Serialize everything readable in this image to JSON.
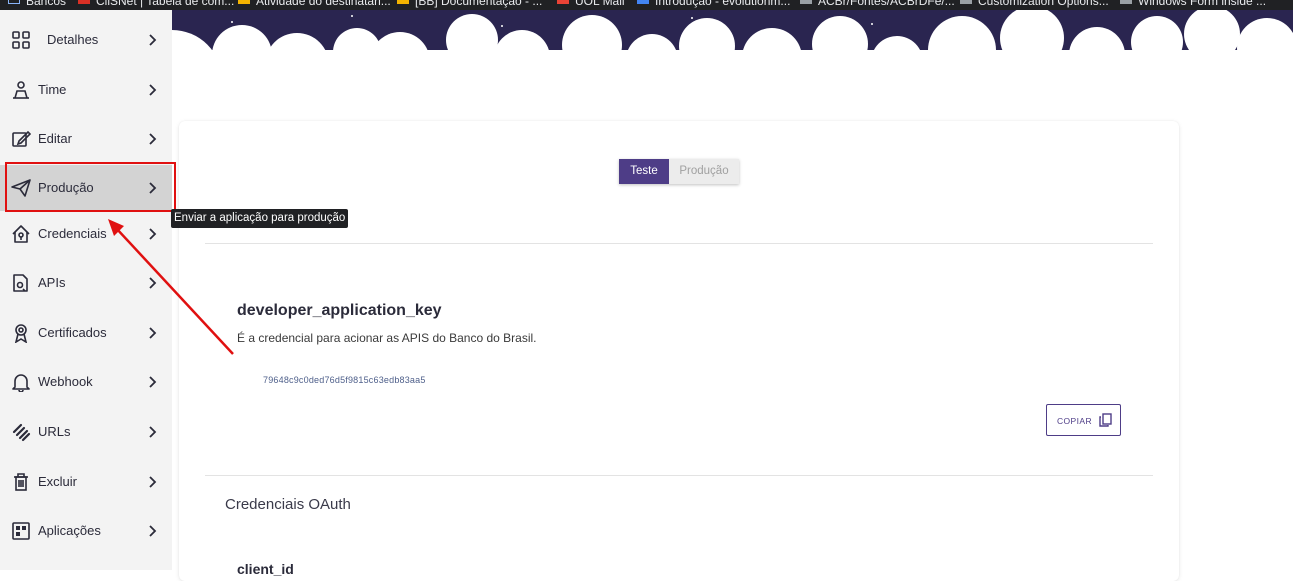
{
  "bookmarks": [
    {
      "label": "Bancos",
      "color": "#8ab4f8"
    },
    {
      "label": "CliSNet | Tabela de com...",
      "color": "#d93025"
    },
    {
      "label": "Atividade do destinatári...",
      "color": "#f4b400"
    },
    {
      "label": "[BB] Documentação - ...",
      "color": "#f4b400"
    },
    {
      "label": "UOL Mail",
      "color": "#ea4335"
    },
    {
      "label": "Introdução - evolutionm...",
      "color": "#4285f4"
    },
    {
      "label": "ACBr/Fontes/ACBrDFe/...",
      "color": "#9aa0a6"
    },
    {
      "label": "Customization Options...",
      "color": "#9aa0a6"
    },
    {
      "label": "Windows Form inside ...",
      "color": "#9aa0a6"
    }
  ],
  "sidebar": {
    "items": [
      {
        "label": "Detalhes",
        "icon": "grid-icon"
      },
      {
        "label": "Time",
        "icon": "team-icon"
      },
      {
        "label": "Editar",
        "icon": "edit-icon"
      },
      {
        "label": "Produção",
        "icon": "send-icon"
      },
      {
        "label": "Credenciais",
        "icon": "home-key-icon"
      },
      {
        "label": "APIs",
        "icon": "api-file-icon"
      },
      {
        "label": "Certificados",
        "icon": "ribbon-icon"
      },
      {
        "label": "Webhook",
        "icon": "bell-icon"
      },
      {
        "label": "URLs",
        "icon": "link-icon"
      },
      {
        "label": "Excluir",
        "icon": "trash-icon"
      },
      {
        "label": "Aplicações",
        "icon": "apps-icon"
      }
    ],
    "active_index": 3
  },
  "tooltip": {
    "text": "Enviar a aplicação para produção"
  },
  "environment_toggle": {
    "selected": "Teste",
    "options": [
      "Teste",
      "Produção"
    ]
  },
  "credential": {
    "name": "developer_application_key",
    "description": "É a credencial para acionar as APIS do Banco do Brasil.",
    "value": "79648c9c0ded76d5f9815c63edb83aa5",
    "copy_label": "COPIAR"
  },
  "oauth": {
    "section_title": "Credenciais OAuth",
    "first_field": "client_id"
  },
  "colors": {
    "accent": "#4e3d87",
    "annotation_red": "#e01010",
    "sidebar_bg": "#f3f3f3",
    "sidebar_active": "#d3d3d3",
    "banner_dark": "#2a2550"
  }
}
